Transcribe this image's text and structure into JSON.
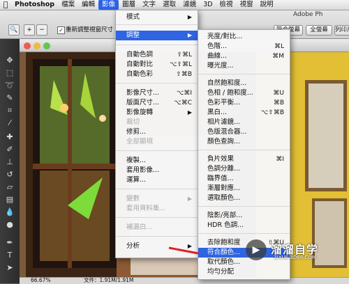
{
  "menubar": {
    "apple": "",
    "items": [
      "Photoshop",
      "檔案",
      "編輯",
      "影像",
      "圖層",
      "文字",
      "選取",
      "濾鏡",
      "3D",
      "檢視",
      "視窗",
      "說明"
    ]
  },
  "options": {
    "resize_checkbox": "✓",
    "resize_label": "重新調整視窗尺寸",
    "btn_actual": "實際像素",
    "btn_fit": "符合螢幕",
    "btn_fill": "全螢幕",
    "btn_print": "列印尺寸",
    "window_title": "Adobe Ph"
  },
  "image_menu": {
    "items": [
      {
        "label": "模式",
        "shortcut": "",
        "arrow": "▶"
      },
      {
        "label": "調整",
        "shortcut": "",
        "arrow": "▶"
      },
      {
        "label": "自動色調",
        "shortcut": "⇧⌘L"
      },
      {
        "label": "自動對比",
        "shortcut": "⌥⇧⌘L"
      },
      {
        "label": "自動色彩",
        "shortcut": "⇧⌘B"
      },
      {
        "label": "影像尺寸...",
        "shortcut": "⌥⌘I"
      },
      {
        "label": "版面尺寸...",
        "shortcut": "⌥⌘C"
      },
      {
        "label": "影像旋轉",
        "shortcut": "",
        "arrow": "▶"
      },
      {
        "label": "裁切",
        "shortcut": ""
      },
      {
        "label": "修剪...",
        "shortcut": ""
      },
      {
        "label": "全部顯現",
        "shortcut": ""
      },
      {
        "label": "複製...",
        "shortcut": ""
      },
      {
        "label": "套用影像...",
        "shortcut": ""
      },
      {
        "label": "運算...",
        "shortcut": ""
      },
      {
        "label": "變數",
        "shortcut": "",
        "arrow": "▶"
      },
      {
        "label": "套用資料集...",
        "shortcut": ""
      },
      {
        "label": "補漏白...",
        "shortcut": ""
      },
      {
        "label": "分析",
        "shortcut": "",
        "arrow": "▶"
      }
    ]
  },
  "adjust_menu": {
    "items": [
      {
        "label": "亮度/對比...",
        "shortcut": ""
      },
      {
        "label": "色階...",
        "shortcut": "⌘L"
      },
      {
        "label": "曲線...",
        "shortcut": "⌘M"
      },
      {
        "label": "曝光度...",
        "shortcut": ""
      },
      {
        "label": "自然飽和度...",
        "shortcut": ""
      },
      {
        "label": "色相 / 飽和度...",
        "shortcut": "⌘U"
      },
      {
        "label": "色彩平衡...",
        "shortcut": "⌘B"
      },
      {
        "label": "黑白...",
        "shortcut": "⌥⇧⌘B"
      },
      {
        "label": "相片濾鏡...",
        "shortcut": ""
      },
      {
        "label": "色版混合器...",
        "shortcut": ""
      },
      {
        "label": "顏色查詢...",
        "shortcut": ""
      },
      {
        "label": "負片效果",
        "shortcut": "⌘I"
      },
      {
        "label": "色調分離...",
        "shortcut": ""
      },
      {
        "label": "臨界值...",
        "shortcut": ""
      },
      {
        "label": "漸層對應...",
        "shortcut": ""
      },
      {
        "label": "選取顏色...",
        "shortcut": ""
      },
      {
        "label": "陰影/亮部...",
        "shortcut": ""
      },
      {
        "label": "HDR 色調...",
        "shortcut": ""
      },
      {
        "label": "去除飽和度",
        "shortcut": "⇧⌘U"
      },
      {
        "label": "符合顏色...",
        "shortcut": ""
      },
      {
        "label": "取代顏色...",
        "shortcut": ""
      },
      {
        "label": "均勻分配",
        "shortcut": ""
      }
    ]
  },
  "status": {
    "zoom": "66.67%",
    "file": "文件：1.91M/1.91M"
  },
  "watermark": {
    "name": "溜溜自学",
    "url": "ZIXUE.3D66.COM"
  },
  "colors": {
    "highlight": "#2f64e2",
    "menubar_active": "#2b63e6"
  }
}
